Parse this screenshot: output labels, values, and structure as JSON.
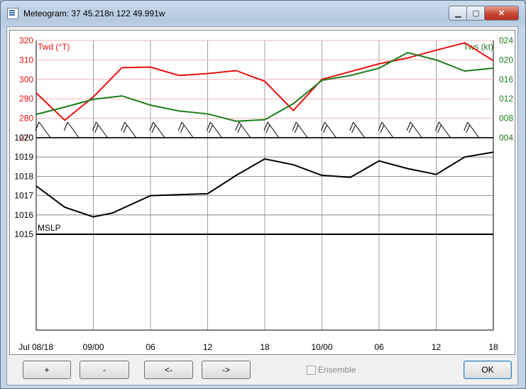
{
  "window": {
    "title": "Meteogram: 37 45.218n 122 49.991w",
    "minimize_label": "▁",
    "maximize_label": "▢",
    "close_label": "✕"
  },
  "buttons": {
    "plus": "+",
    "minus": "-",
    "prev": "<-",
    "next": "->",
    "ok": "OK"
  },
  "ensemble": {
    "label": "Ensemble",
    "checked": false
  },
  "colors": {
    "twd": "#e81010",
    "tws": "#1a7d1a",
    "mslp": "#000000",
    "grid": "#9a9a9a",
    "twd_grid": "#f4b3b3"
  },
  "chart_data": [
    {
      "type": "line",
      "panel": "wind",
      "series": [
        {
          "name": "Twd (°T)",
          "axis": "left",
          "color": "#e81010",
          "x": [
            0,
            6,
            12,
            18,
            24,
            30,
            36,
            42,
            48,
            54,
            60,
            66,
            72,
            78,
            84
          ],
          "values": [
            293,
            279,
            291,
            306,
            306.3,
            302,
            303,
            304.5,
            299,
            284,
            300,
            304,
            308,
            311,
            315
          ]
        },
        {
          "name": "Tws (kt)",
          "axis": "right",
          "color": "#1a7d1a",
          "x": [
            0,
            6,
            12,
            18,
            24,
            30,
            36,
            42,
            48,
            54,
            60,
            66,
            72,
            78,
            84
          ],
          "values": [
            8.8,
            10.3,
            11.9,
            12.6,
            10.7,
            9.5,
            8.9,
            7.4,
            7.7,
            11,
            15.8,
            16.8,
            18.3,
            21.5,
            20
          ]
        }
      ],
      "extra_points": {
        "twd_end": [
          96,
          309.6
        ],
        "twd_peak": [
          90,
          318.8
        ],
        "tws_tail": [
          [
            90,
            17.7
          ],
          [
            96,
            18.3
          ]
        ]
      },
      "left_axis": {
        "ticks": [
          "320",
          "310",
          "300",
          "290",
          "280",
          "270"
        ],
        "ylim": [
          270,
          320
        ]
      },
      "right_axis": {
        "ticks": [
          "024",
          "020",
          "016",
          "012",
          "008",
          "004"
        ],
        "ylim": [
          4,
          24
        ]
      },
      "barbs": [
        0,
        6,
        12,
        18,
        24,
        30,
        36,
        42,
        48,
        54,
        60,
        66,
        72,
        78,
        84,
        90
      ]
    },
    {
      "type": "line",
      "panel": "pressure",
      "series": [
        {
          "name": "MSLP",
          "color": "#000000",
          "x": [
            0,
            6,
            12,
            16,
            24,
            30,
            36,
            42,
            48,
            54,
            60,
            66,
            72,
            78,
            84,
            90,
            96
          ],
          "values": [
            1017.5,
            1016.4,
            1015.9,
            1016.1,
            1017.0,
            1017.05,
            1017.1,
            1018.05,
            1018.9,
            1018.6,
            1018.05,
            1017.95,
            1018.8,
            1018.4,
            1018.1,
            1019.0,
            1019.25
          ]
        }
      ],
      "ylabel": "MSLP",
      "y_ticks": [
        "1020",
        "1019",
        "1018",
        "1017",
        "1016",
        "1015"
      ],
      "ylim": [
        1015,
        1020
      ]
    }
  ],
  "x_axis": {
    "labels": [
      "Jul 08/18",
      "09/00",
      "06",
      "12",
      "18",
      "10/00",
      "06",
      "12",
      "18"
    ],
    "hours": [
      0,
      12,
      24,
      36,
      48,
      60,
      72,
      84,
      96
    ]
  },
  "panel_labels": {
    "twd": "Twd (°T)",
    "tws": "Tws (kt)"
  }
}
